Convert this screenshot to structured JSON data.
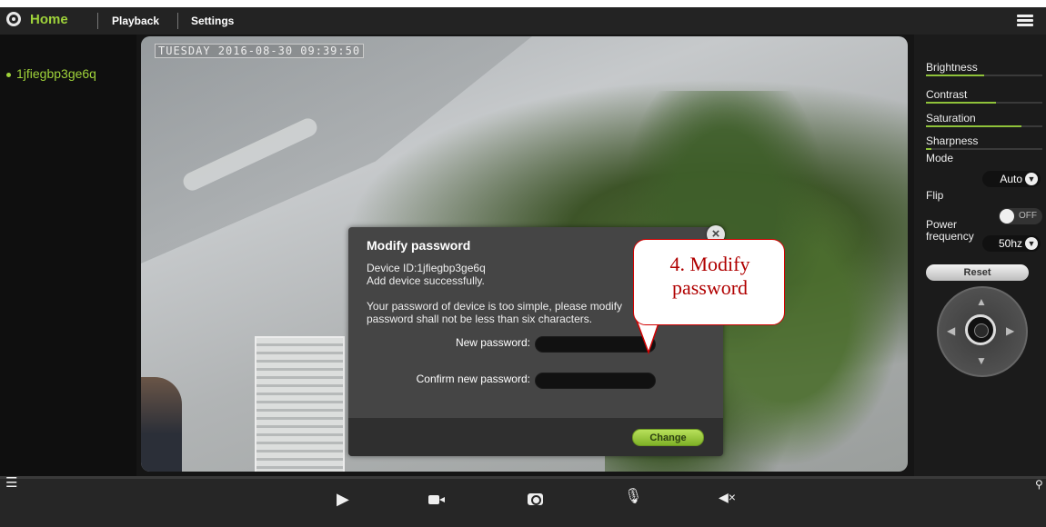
{
  "nav": {
    "home": "Home",
    "playback": "Playback",
    "settings": "Settings"
  },
  "sidebar": {
    "devices": [
      "1jfiegbp3ge6q"
    ]
  },
  "video": {
    "timestamp": "TUESDAY 2016-08-30 09:39:50"
  },
  "image_controls": {
    "sliders": [
      {
        "label": "Brightness",
        "value": 0.5
      },
      {
        "label": "Contrast",
        "value": 0.6
      },
      {
        "label": "Saturation",
        "value": 0.82
      },
      {
        "label": "Sharpness",
        "value": 0.05
      }
    ],
    "mode_label": "Mode",
    "mode_value": "Auto",
    "flip_label": "Flip",
    "flip_value": "OFF",
    "power_frequency_label": "Power frequency",
    "power_frequency_value": "50hz",
    "reset_label": "Reset"
  },
  "modal": {
    "title": "Modify password",
    "device_id": "Device ID:1jfiegbp3ge6q",
    "success_msg": "Add device successfully.",
    "warning_line1": "Your password of device is too simple, please modify",
    "warning_line2": "password shall not be less than six characters.",
    "new_password_label": "New password:",
    "confirm_password_label": "Confirm new password:",
    "new_password_value": "",
    "confirm_password_value": "",
    "change_label": "Change",
    "close_symbol": "×"
  },
  "annotation": {
    "line1": "4. Modify",
    "line2": "password"
  },
  "colors": {
    "accent_green": "#9fd33a",
    "callout_red": "#d10000"
  },
  "icons": [
    "wrench-icon",
    "plus-icon",
    "refresh-icon",
    "menu-icon",
    "play-icon",
    "record-icon",
    "snapshot-icon",
    "mic-mute-icon",
    "speaker-mute-icon",
    "location-icon"
  ]
}
